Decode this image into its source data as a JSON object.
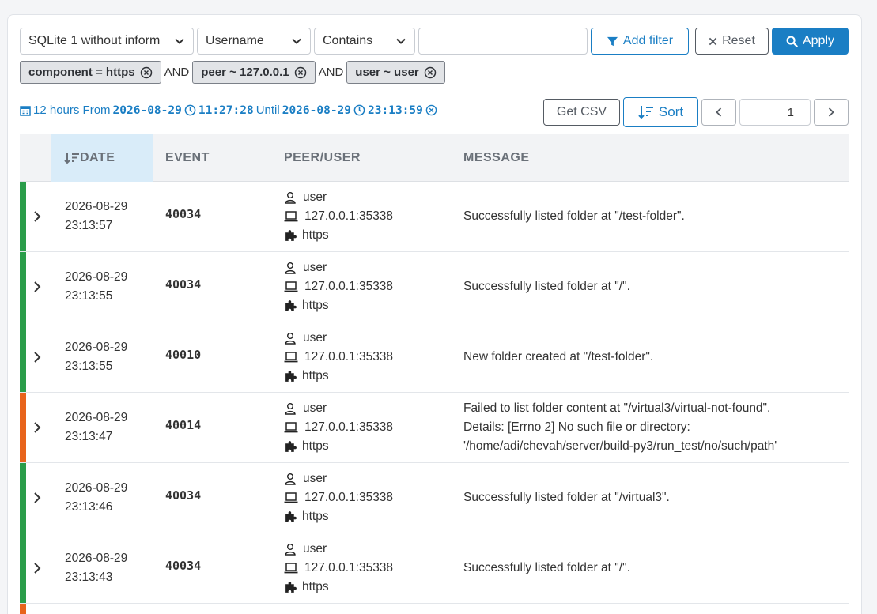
{
  "filters": {
    "source_select": "SQLite 1 without inform",
    "field_select": "Username",
    "operator_select": "Contains",
    "value_input": "",
    "add_filter_label": "Add filter",
    "reset_label": "Reset",
    "apply_label": "Apply"
  },
  "chips": [
    {
      "label": "component = https"
    },
    {
      "label": "peer ~ 127.0.0.1"
    },
    {
      "label": "user ~ user"
    }
  ],
  "chip_joiner": "AND",
  "range": {
    "duration": "12 hours From",
    "from_date": "2026-08-29",
    "from_time": "11:27:28",
    "until_label": "Until",
    "until_date": "2026-08-29",
    "until_time": "23:13:59"
  },
  "toolbar": {
    "csv_label": "Get CSV",
    "sort_label": "Sort",
    "page": "1"
  },
  "table": {
    "columns": [
      "DATE",
      "EVENT",
      "PEER/USER",
      "MESSAGE"
    ],
    "rows": [
      {
        "status": "success",
        "date": "2026-08-29",
        "time": "23:13:57",
        "event": "40034",
        "user": "user",
        "peer": "127.0.0.1:35338",
        "component": "https",
        "message": [
          "Successfully listed folder at \"/test-folder\"."
        ]
      },
      {
        "status": "success",
        "date": "2026-08-29",
        "time": "23:13:55",
        "event": "40034",
        "user": "user",
        "peer": "127.0.0.1:35338",
        "component": "https",
        "message": [
          "Successfully listed folder at \"/\"."
        ]
      },
      {
        "status": "success",
        "date": "2026-08-29",
        "time": "23:13:55",
        "event": "40010",
        "user": "user",
        "peer": "127.0.0.1:35338",
        "component": "https",
        "message": [
          "New folder created at \"/test-folder\"."
        ]
      },
      {
        "status": "error",
        "date": "2026-08-29",
        "time": "23:13:47",
        "event": "40014",
        "user": "user",
        "peer": "127.0.0.1:35338",
        "component": "https",
        "message": [
          "Failed to list folder content at \"/virtual3/virtual-not-found\".",
          "Details: [Errno 2] No such file or directory:",
          "'/home/adi/chevah/server/build-py3/run_test/no/such/path'"
        ]
      },
      {
        "status": "success",
        "date": "2026-08-29",
        "time": "23:13:46",
        "event": "40034",
        "user": "user",
        "peer": "127.0.0.1:35338",
        "component": "https",
        "message": [
          "Successfully listed folder at \"/virtual3\"."
        ]
      },
      {
        "status": "success",
        "date": "2026-08-29",
        "time": "23:13:43",
        "event": "40034",
        "user": "user",
        "peer": "127.0.0.1:35338",
        "component": "https",
        "message": [
          "Successfully listed folder at \"/\"."
        ]
      }
    ]
  },
  "colors": {
    "accent": "#1a7ec4",
    "success": "#2a9d4a",
    "error": "#e8641c"
  }
}
